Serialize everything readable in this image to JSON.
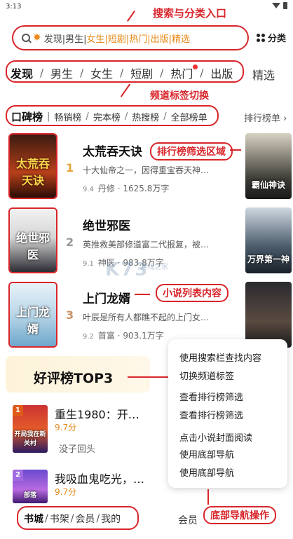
{
  "status_bar": {
    "time": "3:13"
  },
  "annotations": {
    "search_entry": "搜索与分类入口",
    "channel_switch": "频道标签切换",
    "rank_filter_area": "排行榜筛选区域",
    "novel_list": "小说列表内容",
    "bottom_nav_ops": "底部导航操作"
  },
  "search": {
    "hint_prefix": "发现|男生|",
    "hint_highlight": "女生|短剧|热门|出版|精选",
    "category_label": "分类"
  },
  "channel_tabs": {
    "items": [
      "发现",
      "男生",
      "女生",
      "短剧",
      "热门",
      "出版"
    ],
    "active": "发现",
    "extra": "精选"
  },
  "rank_tabs": {
    "active": "口碑榜",
    "items": [
      "畅销榜",
      "完本榜",
      "热搜榜",
      "全部榜单"
    ],
    "more_label": "排行榜单 ›"
  },
  "books": [
    {
      "rank": "1",
      "title": "太荒吞天诀",
      "desc": "十大仙帝之一，因得重宝吞天神…",
      "score": "9.4",
      "author": "丹修",
      "words": "1625.8万字",
      "cover_text": "太荒吞天诀",
      "side_cover_text": "霸仙神诀",
      "rank_color": "#e6a23a"
    },
    {
      "rank": "2",
      "title": "绝世邪医",
      "desc": "英推救美部修道富二代报复，被…",
      "score": "9.1",
      "author": "神医",
      "words": "983.8万字",
      "cover_text": "绝世邪医",
      "side_cover_text": "万界第一神",
      "rank_color": "#999999"
    },
    {
      "rank": "3",
      "title": "上门龙婿",
      "desc": "叶辰是所有人都瞧不起的上门女…",
      "score": "9.2",
      "author": "首富",
      "words": "903.1万字",
      "cover_text": "上门龙婿",
      "side_cover_text": "",
      "rank_color": "#c9926a"
    }
  ],
  "watermark": {
    "text": "K73",
    "sub": "游戏之家"
  },
  "top3": {
    "label": "好评榜TOP3",
    "items": [
      {
        "rank": "1",
        "title": "重生1980：开…",
        "score": "9.7分",
        "author": "没子回头",
        "cover_text": "开局我在新关村"
      },
      {
        "rank": "2",
        "title": "我吸血鬼吃光，…",
        "score": "9.7分",
        "cover_text": "部落"
      }
    ]
  },
  "popup": {
    "items": [
      "使用搜索栏查找内容",
      "切换频道标签",
      "查看排行榜筛选",
      "查看排行榜筛选",
      "点击小说封面阅读",
      "使用底部导航",
      "使用底部导航"
    ]
  },
  "bottom_nav": {
    "items": [
      "书城",
      "书架",
      "会员",
      "我的"
    ],
    "active": "书城",
    "member": "会员"
  }
}
